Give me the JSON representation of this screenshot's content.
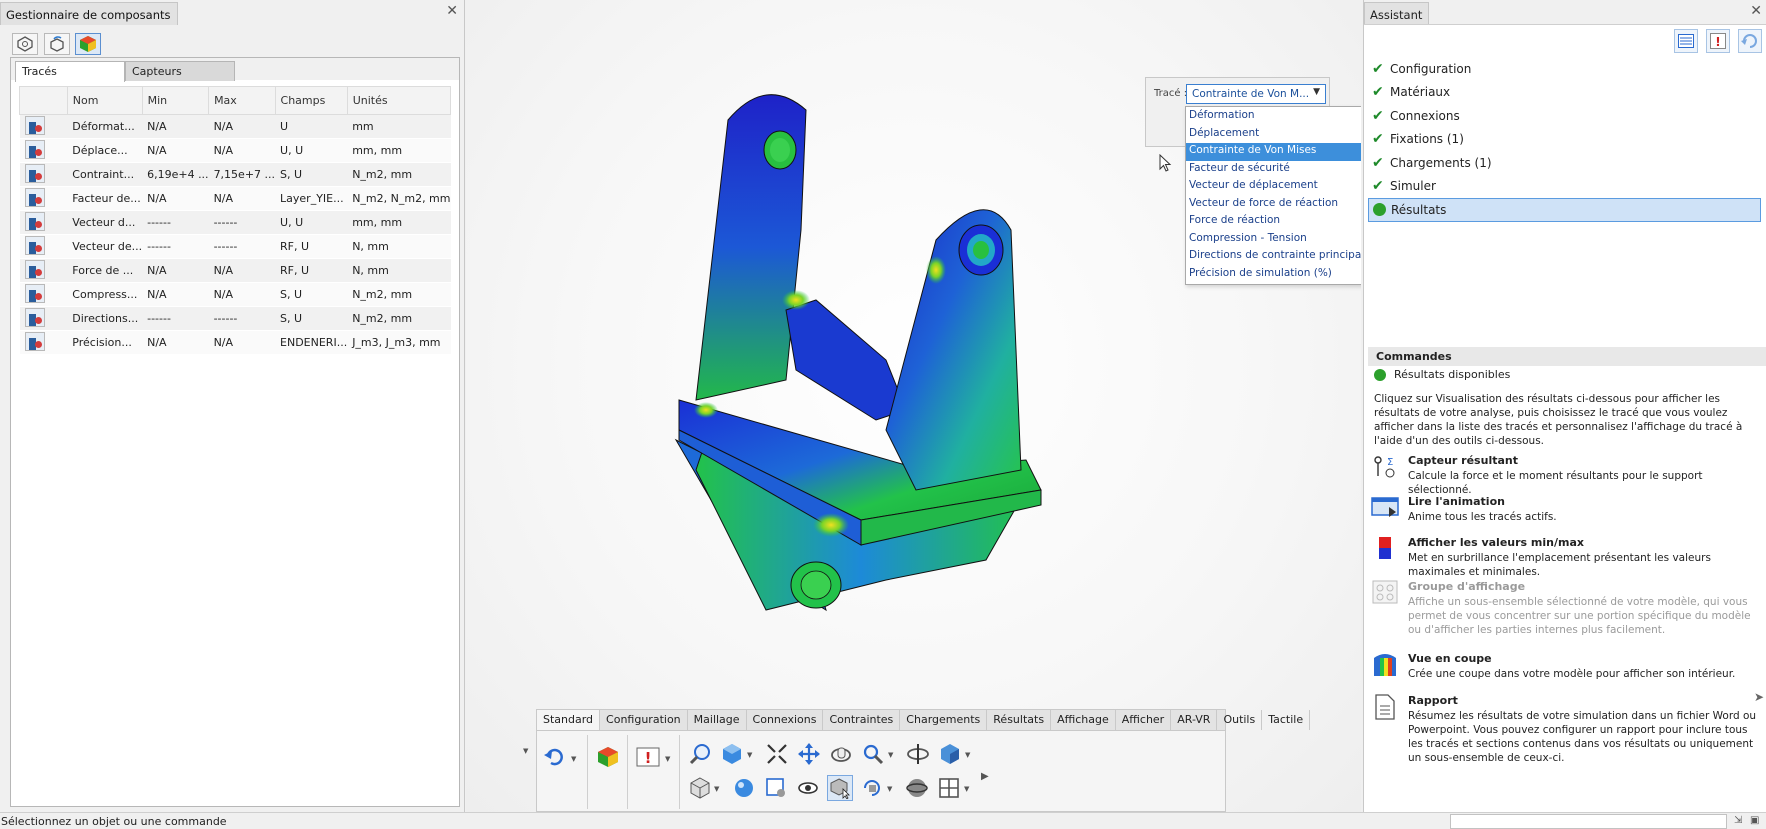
{
  "left_panel": {
    "title": "Gestionnaire de composants",
    "close": "✕",
    "tabs": [
      "Tracés",
      "Capteurs"
    ],
    "columns": [
      "Nom",
      "Min",
      "Max",
      "Champs",
      "Unités"
    ],
    "rows": [
      [
        "Déformat...",
        "N/A",
        "N/A",
        "U",
        "mm"
      ],
      [
        "Déplace...",
        "N/A",
        "N/A",
        "U, U",
        "mm, mm"
      ],
      [
        "Contraint...",
        "6,19e+4 ...",
        "7,15e+7 ...",
        "S, U",
        "N_m2, mm"
      ],
      [
        "Facteur de...",
        "N/A",
        "N/A",
        "Layer_YIE...",
        "N_m2, N_m2, mm"
      ],
      [
        "Vecteur d...",
        "------",
        "------",
        "U, U",
        "mm, mm"
      ],
      [
        "Vecteur de...",
        "------",
        "------",
        "RF, U",
        "N, mm"
      ],
      [
        "Force de ...",
        "N/A",
        "N/A",
        "RF, U",
        "N, mm"
      ],
      [
        "Compress...",
        "N/A",
        "N/A",
        "S, U",
        "N_m2, mm"
      ],
      [
        "Directions...",
        "------",
        "------",
        "S, U",
        "N_m2, mm"
      ],
      [
        "Précision...",
        "N/A",
        "N/A",
        "ENDENERI...",
        "J_m3, J_m3, mm"
      ]
    ]
  },
  "viewport": {
    "trace_label": "Tracé :",
    "trace_selected": "Contrainte de Von M...",
    "dropdown_options": [
      "Déformation",
      "Déplacement",
      "Contrainte de Von Mises",
      "Facteur de sécurité",
      "Vecteur de déplacement",
      "Vecteur de force de réaction",
      "Force de réaction",
      "Compression - Tension",
      "Directions de contrainte principales",
      "Précision de simulation (%)"
    ],
    "dropdown_selected_index": 2
  },
  "ribbon": {
    "tabs": [
      "Standard",
      "Configuration",
      "Maillage",
      "Connexions",
      "Contraintes",
      "Chargements",
      "Résultats",
      "Affichage",
      "Afficher",
      "AR-VR",
      "Outils",
      "Tactile"
    ],
    "active_tab": "Standard"
  },
  "right_panel": {
    "title": "Assistant",
    "close": "✕",
    "steps": [
      {
        "label": "Configuration",
        "state": "done"
      },
      {
        "label": "Matériaux",
        "state": "done"
      },
      {
        "label": "Connexions",
        "state": "done"
      },
      {
        "label": "Fixations (1)",
        "state": "done"
      },
      {
        "label": "Chargements (1)",
        "state": "done"
      },
      {
        "label": "Simuler",
        "state": "done"
      },
      {
        "label": "Résultats",
        "state": "active"
      }
    ],
    "commands_header": "Commandes",
    "available": "Résultats disponibles",
    "intro": "Cliquez sur Visualisation des résultats ci-dessous pour afficher les résultats de votre analyse, puis choisissez le tracé que vous voulez afficher dans la liste des tracés et personnalisez l'affichage du tracé à l'aide d'un des outils ci-dessous.",
    "commands": [
      {
        "title": "Capteur résultant",
        "desc": "Calcule la force et le moment résultants pour le support sélectionné.",
        "icon": "resultant-sensor-icon",
        "enabled": true
      },
      {
        "title": "Lire l'animation",
        "desc": "Anime tous les tracés actifs.",
        "icon": "animation-icon",
        "enabled": true
      },
      {
        "title": "Afficher les valeurs min/max",
        "desc": "Met en surbrillance l'emplacement présentant les valeurs maximales et minimales.",
        "icon": "min-max-icon",
        "enabled": true
      },
      {
        "title": "Groupe d'affichage",
        "desc": "Affiche un sous-ensemble sélectionné de votre modèle, qui vous permet de vous concentrer sur une portion spécifique du modèle ou d'afficher les parties internes plus facilement.",
        "icon": "display-group-icon",
        "enabled": false
      },
      {
        "title": "Vue en coupe",
        "desc": "Crée une coupe dans votre modèle pour afficher son intérieur.",
        "icon": "section-view-icon",
        "enabled": true
      },
      {
        "title": "Rapport",
        "desc": "Résumez les résultats de votre simulation dans un fichier Word ou Powerpoint. Vous pouvez configurer un rapport pour inclure tous les tracés et sections contenus dans vos résultats ou uniquement un sous-ensemble de ceux-ci.",
        "icon": "report-icon",
        "enabled": true
      }
    ]
  },
  "status": {
    "message": "Sélectionnez un objet ou une commande"
  },
  "colors": {
    "accent": "#3d8fdb",
    "check": "#1e8a2a",
    "stress_low": "#1a2fd6",
    "stress_mid": "#22c24a",
    "stress_high": "#f0e020"
  }
}
